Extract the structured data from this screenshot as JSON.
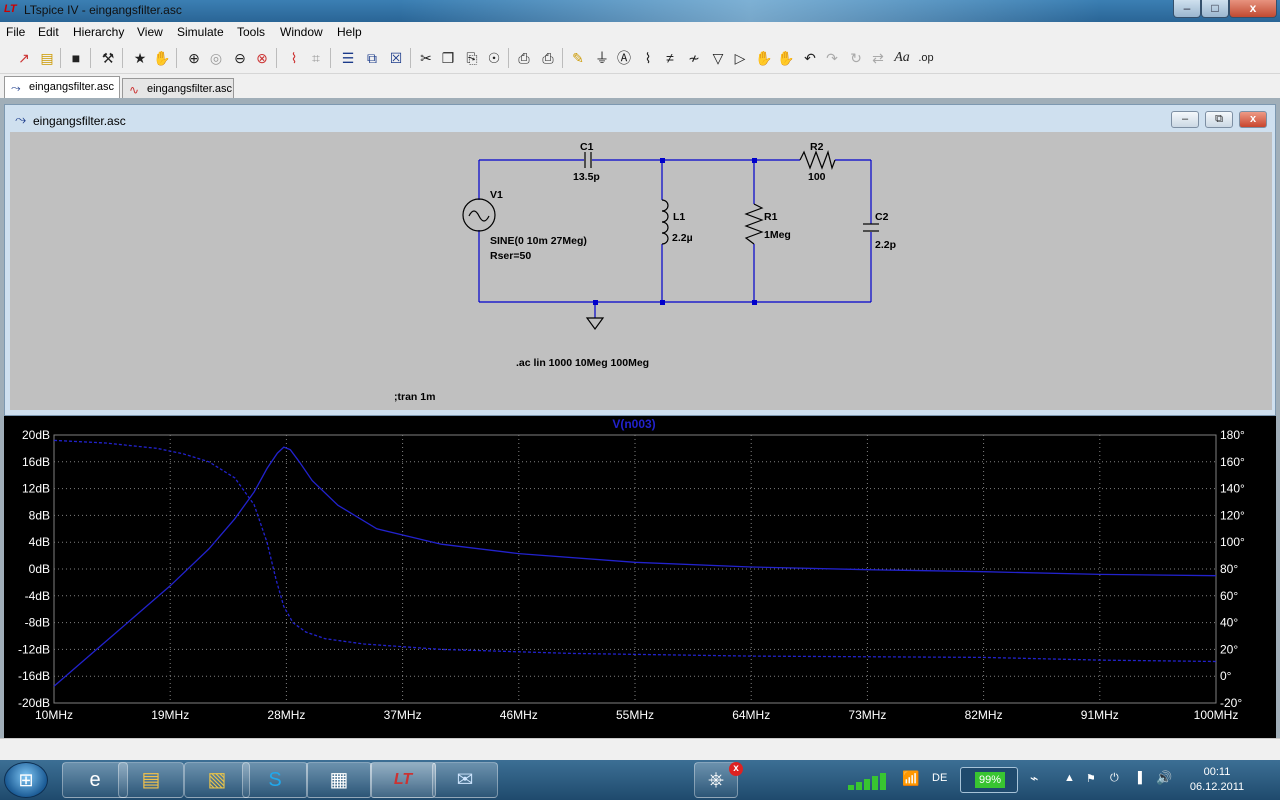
{
  "window": {
    "title": "LTspice IV - eingangsfilter.asc",
    "app_icon": "ltspice-icon",
    "controls": {
      "minimize": "–",
      "maximize": "□",
      "close": "x"
    }
  },
  "menu": [
    "File",
    "Edit",
    "Hierarchy",
    "View",
    "Simulate",
    "Tools",
    "Window",
    "Help"
  ],
  "toolbar": {
    "icons": [
      "new-schematic-icon",
      "open-icon",
      "save-icon",
      "control-panel-icon",
      "run-icon",
      "halt-icon",
      "zoom-in-icon",
      "zoom-pan-icon",
      "zoom-out-icon",
      "zoom-fit-icon",
      "waveform-icon",
      "autorange-icon",
      "tile-horizontal-icon",
      "cascade-icon",
      "close-all-icon",
      "cut-icon",
      "copy-icon",
      "paste-icon",
      "find-icon",
      "print-preview-icon",
      "print-icon",
      "draw-wire-icon",
      "ground-icon",
      "label-net-icon",
      "resistor-icon",
      "capacitor-icon",
      "inductor-icon",
      "diode-icon",
      "component-icon",
      "move-icon",
      "drag-icon",
      "undo-icon",
      "redo-icon",
      "rotate-icon",
      "mirror-icon",
      "text-icon",
      "spice-directive-icon"
    ]
  },
  "tabs": [
    {
      "label": "eingangsfilter.asc",
      "icon": "schematic-icon"
    },
    {
      "label": "eingangsfilter.asc",
      "icon": "waveform-icon"
    }
  ],
  "schematic": {
    "title": "eingangsfilter.asc",
    "components": {
      "c1_name": "C1",
      "c1_value": "13.5p",
      "r2_name": "R2",
      "r2_value": "100",
      "v1_name": "V1",
      "v1_value": "SINE(0 10m 27Meg)",
      "v1_rser": "Rser=50",
      "l1_name": "L1",
      "l1_value": "2.2µ",
      "r1_name": "R1",
      "r1_value": "1Meg",
      "c2_name": "C2",
      "c2_value": "2.2p"
    },
    "directives": {
      "ac": ".ac lin 1000 10Meg 100Meg",
      "tran": ";tran 1m"
    }
  },
  "chart_data": {
    "type": "line",
    "title": "V(n003)",
    "xlabel": "",
    "ylabel": "",
    "x_ticks": [
      "10MHz",
      "19MHz",
      "28MHz",
      "37MHz",
      "46MHz",
      "55MHz",
      "64MHz",
      "73MHz",
      "82MHz",
      "91MHz",
      "100MHz"
    ],
    "y_ticks_left": [
      "20dB",
      "16dB",
      "12dB",
      "8dB",
      "4dB",
      "0dB",
      "-4dB",
      "-8dB",
      "-12dB",
      "-16dB",
      "-20dB"
    ],
    "y_ticks_right": [
      "180°",
      "160°",
      "140°",
      "120°",
      "100°",
      "80°",
      "60°",
      "40°",
      "20°",
      "0°",
      "-20°"
    ],
    "xlim": [
      10,
      100
    ],
    "ylim_left": [
      -20,
      20
    ],
    "ylim_right": [
      -20,
      180
    ],
    "grid": true,
    "series": [
      {
        "axis": "magnitude_dB",
        "style": "solid",
        "color": "#2222cc",
        "x": [
          10,
          13,
          16,
          19,
          22,
          24,
          25.5,
          26.5,
          27.3,
          27.8,
          28.3,
          29,
          30,
          32,
          35,
          40,
          46,
          55,
          64,
          73,
          82,
          91,
          100
        ],
        "y": [
          -17.5,
          -12.5,
          -7.5,
          -2.5,
          3,
          7.5,
          11.5,
          15,
          17.3,
          18.2,
          17.8,
          16,
          13.2,
          9.5,
          6,
          3.7,
          2.3,
          1,
          0.3,
          -0.1,
          -0.4,
          -0.8,
          -1
        ]
      },
      {
        "axis": "phase_deg",
        "style": "dashed",
        "color": "#2222cc",
        "x": [
          10,
          14,
          18,
          20,
          22,
          24,
          25.5,
          26.5,
          27.2,
          27.8,
          28.5,
          29.5,
          31,
          34,
          40,
          50,
          64,
          82,
          91,
          100
        ],
        "y": [
          176,
          174,
          170,
          166,
          160,
          148,
          128,
          100,
          72,
          52,
          40,
          33,
          28,
          24,
          20,
          17,
          15,
          14,
          12,
          11
        ]
      }
    ]
  },
  "taskbar": {
    "start": "⊞",
    "tasks": [
      "ie-icon",
      "explorer-icon",
      "libraries-icon",
      "skype-icon",
      "calculator-icon",
      "ltspice-icon",
      "thunderbird-icon"
    ],
    "tray_badge": "x",
    "language": "DE",
    "battery": "99%",
    "time": "00:11",
    "date": "06.12.2011"
  }
}
